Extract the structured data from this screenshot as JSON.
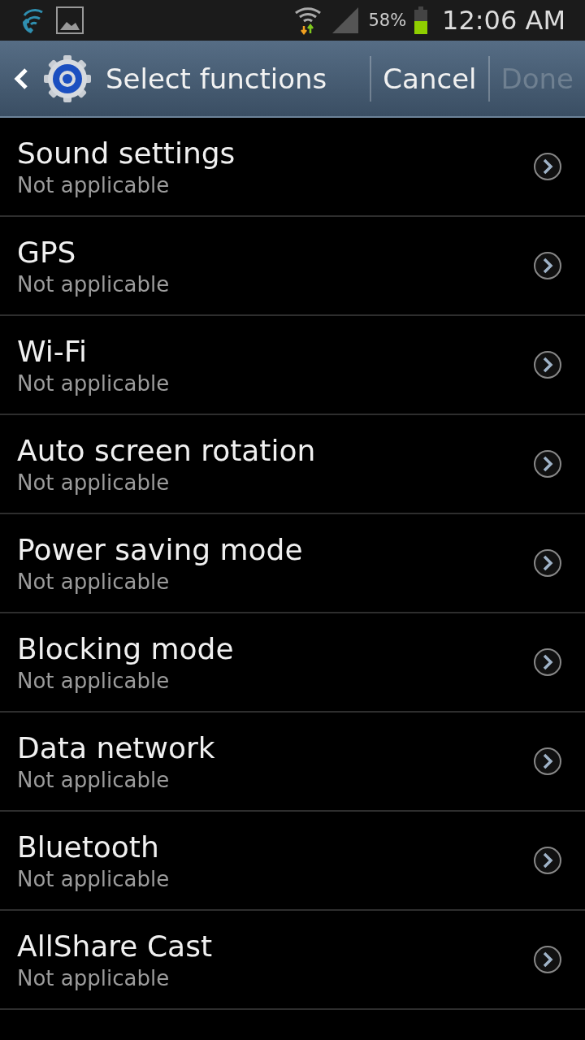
{
  "status_bar": {
    "battery_percent": "58%",
    "time": "12:06 AM"
  },
  "action_bar": {
    "title": "Select functions",
    "buttons": [
      {
        "label": "Cancel",
        "disabled": false
      },
      {
        "label": "Done",
        "disabled": true
      }
    ]
  },
  "items": [
    {
      "title": "Sound settings",
      "subtitle": "Not applicable"
    },
    {
      "title": "GPS",
      "subtitle": "Not applicable"
    },
    {
      "title": "Wi-Fi",
      "subtitle": "Not applicable"
    },
    {
      "title": "Auto screen rotation",
      "subtitle": "Not applicable"
    },
    {
      "title": "Power saving mode",
      "subtitle": "Not applicable"
    },
    {
      "title": "Blocking mode",
      "subtitle": "Not applicable"
    },
    {
      "title": "Data network",
      "subtitle": "Not applicable"
    },
    {
      "title": "Bluetooth",
      "subtitle": "Not applicable"
    },
    {
      "title": "AllShare Cast",
      "subtitle": "Not applicable"
    }
  ]
}
